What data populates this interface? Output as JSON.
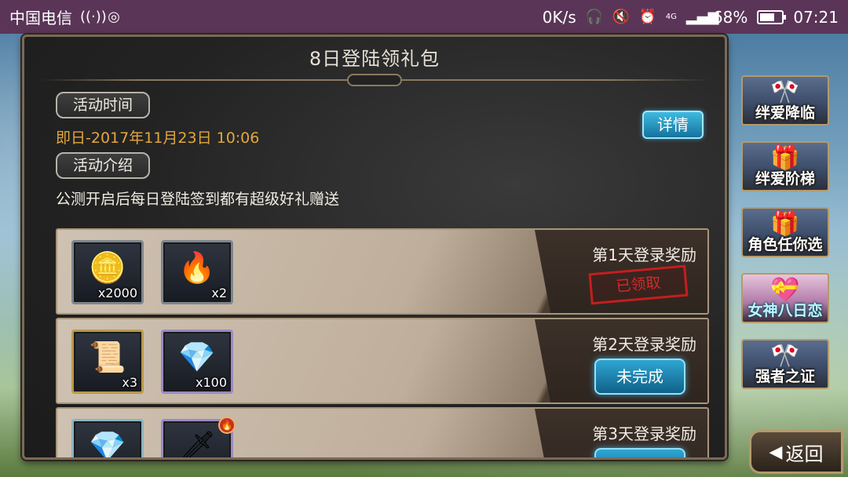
{
  "status_bar": {
    "carrier": "中国电信",
    "net_speed": "0K/s",
    "battery": "68%",
    "battery_level": 0.68,
    "time": "07:21",
    "network_type": "4G"
  },
  "panel": {
    "title": "8日登陆领礼包",
    "time_tag": "活动时间",
    "date_range": "即日-2017年11月23日 10:06",
    "intro_tag": "活动介绍",
    "description": "公测开启后每日登陆签到都有超级好礼赠送",
    "detail_button": "详情"
  },
  "rewards": [
    {
      "day_label": "第1天登录奖励",
      "items": [
        {
          "icon": "gold-coins-icon",
          "qty": "x2000"
        },
        {
          "icon": "fire-orb-icon",
          "qty": "x2"
        }
      ],
      "status": "已领取",
      "status_type": "claimed"
    },
    {
      "day_label": "第2天登录奖励",
      "items": [
        {
          "icon": "scroll-icon",
          "qty": "x3"
        },
        {
          "icon": "crystal-icon",
          "qty": "x100"
        }
      ],
      "status": "未完成",
      "status_type": "incomplete"
    },
    {
      "day_label": "第3天登录奖励",
      "items": [
        {
          "icon": "crystal-icon",
          "qty": ""
        },
        {
          "icon": "weapon-icon",
          "qty": ""
        }
      ],
      "status": "",
      "status_type": "incomplete"
    }
  ],
  "sidenav": [
    {
      "label": "绊爱降临",
      "icon": "banner-icon"
    },
    {
      "label": "绊爱阶梯",
      "icon": "gift-box-icon"
    },
    {
      "label": "角色任你选",
      "icon": "gift-box-icon"
    },
    {
      "label": "女神八日恋",
      "icon": "pink-gift-icon"
    },
    {
      "label": "强者之证",
      "icon": "banner-icon"
    }
  ],
  "back_button": "返回"
}
